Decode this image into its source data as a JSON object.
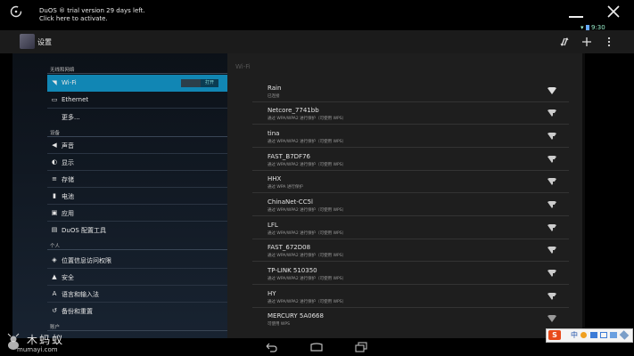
{
  "notification": {
    "trial_line1": "DuOS ® trial version 29 days left.",
    "trial_line2": "Click here to activate."
  },
  "status": {
    "time": "9:30"
  },
  "action_bar": {
    "title": "设置"
  },
  "sidebar": {
    "section_wireless": "无线和网络",
    "wifi": {
      "label": "Wi-Fi",
      "toggle": "打开"
    },
    "ethernet": "Ethernet",
    "more": "更多...",
    "section_device": "设备",
    "device_items": [
      "声音",
      "显示",
      "存储",
      "电池",
      "应用",
      "DuOS 配置工具"
    ],
    "section_personal": "个人",
    "personal_items": [
      "位置信息访问权限",
      "安全",
      "语言和输入法",
      "备份和重置"
    ],
    "section_accounts": "账户"
  },
  "wifi_panel": {
    "header": "Wi-Fi",
    "networks": [
      {
        "name": "Rain",
        "status": "已连接"
      },
      {
        "name": "Netcore_7741bb",
        "status": "通过 WPA/WPA2 进行保护（可使用 WPS）"
      },
      {
        "name": "tina",
        "status": "通过 WPA/WPA2 进行保护（可使用 WPS）"
      },
      {
        "name": "FAST_B7DF76",
        "status": "通过 WPA/WPA2 进行保护（可使用 WPS）"
      },
      {
        "name": "HHX",
        "status": "通过 WPA 进行保护"
      },
      {
        "name": "ChinaNet-CC5l",
        "status": "通过 WPA/WPA2 进行保护（可使用 WPS）"
      },
      {
        "name": "LFL",
        "status": "通过 WPA/WPA2 进行保护（可使用 WPS）"
      },
      {
        "name": "FAST_672D08",
        "status": "通过 WPA/WPA2 进行保护（可使用 WPS）"
      },
      {
        "name": "TP-LINK 510350",
        "status": "通过 WPA/WPA2 进行保护（可使用 WPS）"
      },
      {
        "name": "HY",
        "status": "通过 WPA/WPA2 进行保护（可使用 WPS）"
      },
      {
        "name": "MERCURY 5A0668",
        "status": "可使用 WPS"
      }
    ]
  },
  "watermark": {
    "brand": "木蚂蚁",
    "url": "mumayi.com"
  },
  "ime": {
    "label": "中"
  },
  "colors": {
    "accent": "#1186b4",
    "panel": "#1e1e1e",
    "sidebar": "#0c1118"
  },
  "icons": {
    "trial": "refresh-icon",
    "minimize": "minimize-icon",
    "close": "close-icon",
    "sync": "sync-icon",
    "add": "plus-icon",
    "more": "overflow-icon",
    "wifi_signal": "wifi-signal-icon"
  }
}
